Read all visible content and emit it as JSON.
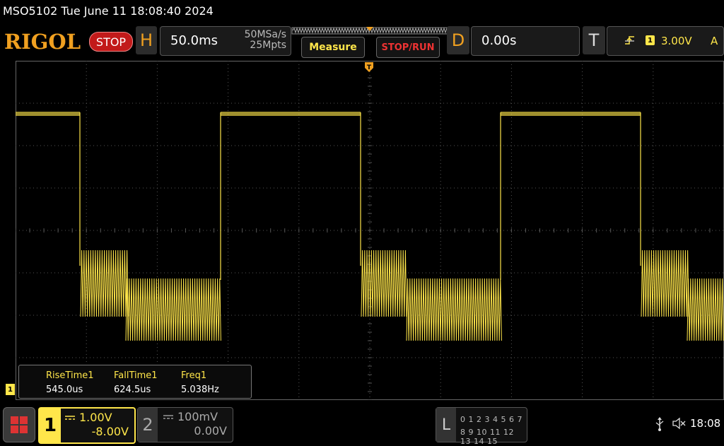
{
  "title": "MSO5102  Tue June 11 18:08:40 2024",
  "brand": {
    "logo": "RIGOL",
    "run_state": "STOP"
  },
  "horizontal": {
    "letter": "H",
    "timebase": "50.0ms",
    "sample_rate": "50MSa/s",
    "memory_depth": "25Mpts"
  },
  "menu": {
    "measure_label": "Measure",
    "stoprun_label": "STOP/RUN"
  },
  "delay": {
    "letter": "D",
    "value": "0.00s"
  },
  "trigger": {
    "letter": "T",
    "channel_badge": "1",
    "level": "3.00V",
    "mode": "A",
    "icon": "rising-edge-icon"
  },
  "measurements": [
    {
      "label": "RiseTime1",
      "value": "545.0us"
    },
    {
      "label": "FallTime1",
      "value": "624.5us"
    },
    {
      "label": "Freq1",
      "value": "5.038Hz"
    }
  ],
  "channel1": {
    "number": "1",
    "scale": "1.00V",
    "offset": "-8.00V",
    "coupling_icon": "dc-coupling-icon",
    "color": "#ffe64a"
  },
  "channel2": {
    "number": "2",
    "scale": "100mV",
    "offset": "0.00V",
    "coupling_icon": "dc-coupling-icon"
  },
  "logic": {
    "letter": "L",
    "row1": "0 1 2 3   4 5 6 7",
    "row2": "8  9 10 11  12 13 14 15"
  },
  "status": {
    "time": "18:08",
    "usb_icon": "usb-icon",
    "sound_icon": "mute-speaker-icon"
  },
  "level_marker": "1",
  "colors": {
    "accent": "#f0a020",
    "trace": "#ffe64a",
    "stop": "#c21a1a",
    "grid": "#555555"
  }
}
